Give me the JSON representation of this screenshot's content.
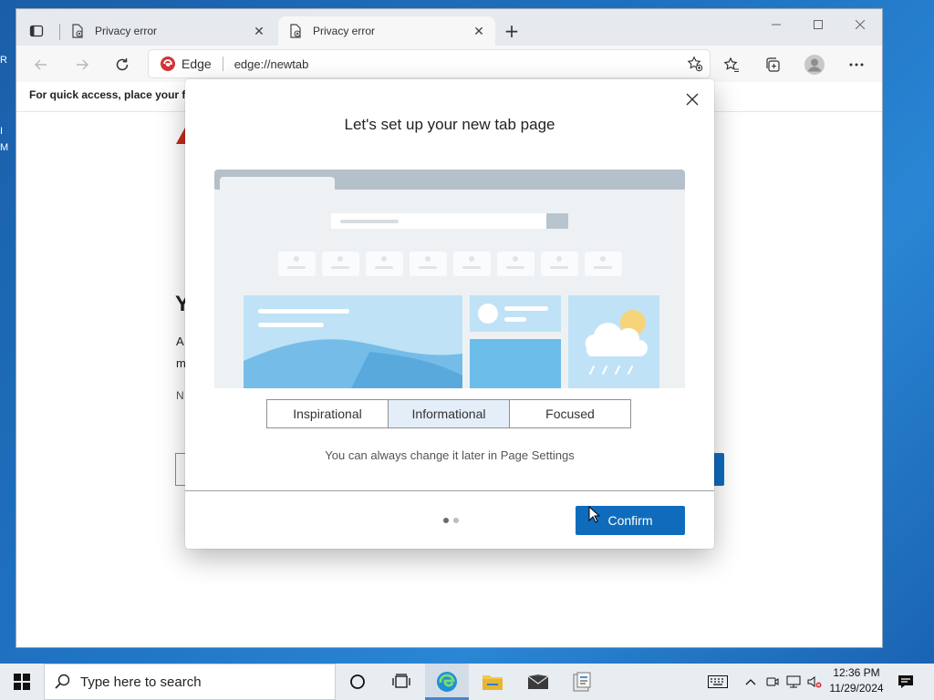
{
  "desktop": {
    "fragments": [
      "R",
      "I",
      "M"
    ]
  },
  "browser": {
    "tabs": [
      {
        "title": "Privacy error",
        "active": false
      },
      {
        "title": "Privacy error",
        "active": true
      }
    ],
    "address": {
      "badge": "Edge",
      "url": "edge://newtab"
    },
    "favorites_bar_text": "For quick access, place your fav",
    "page_fragments": {
      "heading": "Y",
      "line1": "A",
      "line2": "m",
      "line3": "N"
    }
  },
  "dialog": {
    "title": "Let's set up your new tab page",
    "layouts": [
      "Inspirational",
      "Informational",
      "Focused"
    ],
    "selected_layout": "Informational",
    "hint": "You can always change it later in Page Settings",
    "confirm_label": "Confirm",
    "page_count": 2,
    "current_page": 1
  },
  "taskbar": {
    "search_placeholder": "Type here to search",
    "time": "12:36 PM",
    "date": "11/29/2024"
  },
  "colors": {
    "accent": "#0f6cbd",
    "error": "#c42b1c",
    "edge_red": "#d13438"
  }
}
